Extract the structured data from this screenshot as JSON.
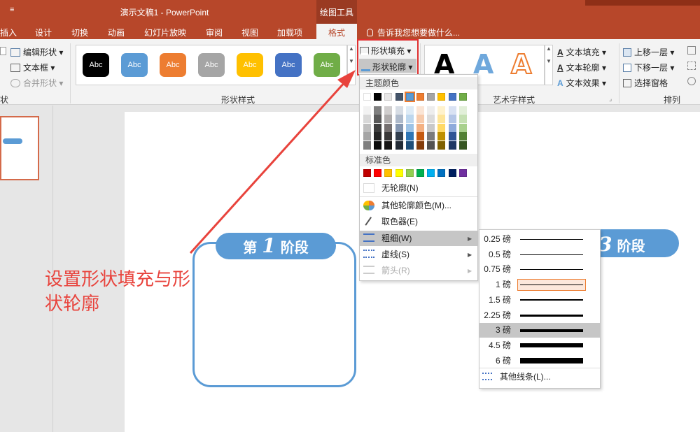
{
  "window": {
    "quick_access": "≡",
    "title": "演示文稿1 - PowerPoint",
    "tools_label": "绘图工具"
  },
  "tabs": [
    "插入",
    "设计",
    "切换",
    "动画",
    "幻灯片放映",
    "审阅",
    "视图",
    "加载项",
    "格式"
  ],
  "tell_me": "告诉我您想要做什么...",
  "ribbon": {
    "insert_shapes": {
      "edit_shape": "编辑形状",
      "text_box": "文本框",
      "merge_shapes": "合并形状",
      "group_label": "状"
    },
    "shape_styles": {
      "group_label": "形状样式",
      "style_label": "Abc",
      "styles": [
        {
          "name": "black",
          "color": "#000000"
        },
        {
          "name": "blue",
          "color": "#5b9bd5"
        },
        {
          "name": "orange",
          "color": "#ed7d31"
        },
        {
          "name": "gray",
          "color": "#a5a5a5"
        },
        {
          "name": "gold",
          "color": "#ffc000"
        },
        {
          "name": "dark-blue",
          "color": "#4472c4"
        },
        {
          "name": "green",
          "color": "#70ad47"
        }
      ],
      "fill": "形状填充",
      "outline": "形状轮廓"
    },
    "wordart": {
      "group_label": "艺术字样式",
      "sample": "A",
      "text_fill": "文本填充",
      "text_outline": "文本轮廓",
      "text_effects": "文本效果"
    },
    "arrange": {
      "group_label": "排列",
      "bring_forward": "上移一层",
      "send_backward": "下移一层",
      "selection_pane": "选择窗格"
    }
  },
  "outline_menu": {
    "theme_colors_label": "主题颜色",
    "theme_top_row": [
      "#ffffff",
      "#000000",
      "#e7e6e6",
      "#44546a",
      "#5b9bd5",
      "#ed7d31",
      "#a5a5a5",
      "#ffc000",
      "#4472c4",
      "#70ad47"
    ],
    "theme_shades": [
      [
        "#f2f2f2",
        "#7f7f7f",
        "#d0cece",
        "#d6dce4",
        "#deebf6",
        "#fbe5d5",
        "#ededed",
        "#fff2cc",
        "#d9e2f3",
        "#e2efd9"
      ],
      [
        "#d8d8d8",
        "#595959",
        "#aeabab",
        "#adb9ca",
        "#bdd7ee",
        "#f7cbac",
        "#dbdbdb",
        "#fee599",
        "#b4c6e7",
        "#c5e0b3"
      ],
      [
        "#bfbfbf",
        "#3f3f3f",
        "#757070",
        "#8496b0",
        "#9dc3e6",
        "#f4b183",
        "#c9c9c9",
        "#ffd965",
        "#8eaadb",
        "#a8d08d"
      ],
      [
        "#a5a5a5",
        "#262626",
        "#3a3838",
        "#323f4f",
        "#2e75b5",
        "#c55a11",
        "#7b7b7b",
        "#bf9000",
        "#2f5496",
        "#538135"
      ],
      [
        "#7f7f7f",
        "#0c0c0c",
        "#171616",
        "#222a35",
        "#1e4e79",
        "#833c0b",
        "#525252",
        "#7f6000",
        "#1f3864",
        "#375623"
      ]
    ],
    "standard_colors_label": "标准色",
    "standard_colors": [
      "#c00000",
      "#ff0000",
      "#ffc000",
      "#ffff00",
      "#92d050",
      "#00b050",
      "#00b0f0",
      "#0070c0",
      "#002060",
      "#7030a0"
    ],
    "no_outline": "无轮廓(N)",
    "more_colors": "其他轮廓颜色(M)...",
    "eyedropper": "取色器(E)",
    "weight": "粗细(W)",
    "dashes": "虚线(S)",
    "arrows": "箭头(R)"
  },
  "weight_menu": {
    "items": [
      {
        "label": "0.25 磅",
        "weight": 0.25
      },
      {
        "label": "0.5 磅",
        "weight": 0.5
      },
      {
        "label": "0.75 磅",
        "weight": 0.75
      },
      {
        "label": "1 磅",
        "weight": 1,
        "state": "current"
      },
      {
        "label": "1.5 磅",
        "weight": 1.5
      },
      {
        "label": "2.25 磅",
        "weight": 2.25
      },
      {
        "label": "3 磅",
        "weight": 3,
        "state": "hovered"
      },
      {
        "label": "4.5 磅",
        "weight": 4.5
      },
      {
        "label": "6 磅",
        "weight": 6
      }
    ],
    "more_lines": "其他线条(L)..."
  },
  "slide": {
    "badge1_prefix": "第",
    "badge1_num": "1",
    "badge1_suffix": "阶段",
    "badge3_num": "3",
    "badge3_suffix": "阶段"
  },
  "annotation": "设置形状填充与形状轮廓",
  "colors": {
    "ribbon_accent": "#b7472a",
    "slide_blue": "#5b9bd5",
    "annotation_red": "#e8433c"
  }
}
